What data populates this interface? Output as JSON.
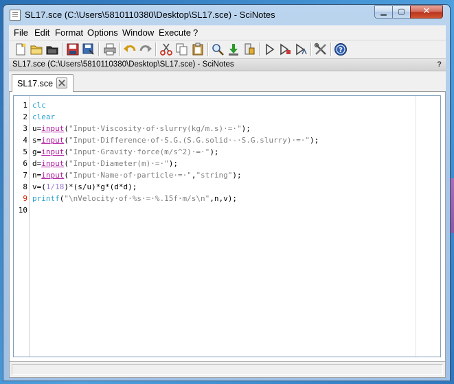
{
  "window": {
    "title": "SL17.sce (C:\\Users\\5810110380\\Desktop\\SL17.sce) - SciNotes",
    "controls": {
      "minimize": "▁",
      "maximize": "▢",
      "close": "✕"
    }
  },
  "menubar": {
    "items": [
      "File",
      "Edit",
      "Format",
      "Options",
      "Window",
      "Execute",
      "?"
    ]
  },
  "toolbar": {
    "icons": [
      "new-file-icon",
      "open-file-icon",
      "open-recent-icon",
      "save-icon",
      "save-as-icon",
      "print-icon",
      "undo-icon",
      "redo-icon",
      "cut-icon",
      "copy-icon",
      "paste-icon",
      "search-replace-icon",
      "load-into-scilab-icon",
      "execute-file-icon",
      "run-icon",
      "run-selection-icon",
      "run-with-echo-icon",
      "preferences-icon",
      "help-icon"
    ]
  },
  "document": {
    "title": "SL17.sce (C:\\Users\\5810110380\\Desktop\\SL17.sce) - SciNotes",
    "help_mark": "?"
  },
  "tabs": [
    {
      "label": "SL17.sce"
    }
  ],
  "editor": {
    "line_numbers": [
      "1",
      "2",
      "3",
      "4",
      "5",
      "6",
      "7",
      "8",
      "9",
      "10"
    ],
    "lines": [
      [
        {
          "t": "clc",
          "c": "kw"
        }
      ],
      [
        {
          "t": "clear",
          "c": "kw"
        }
      ],
      [
        {
          "t": "u="
        },
        {
          "t": "input",
          "c": "fn"
        },
        {
          "t": "("
        },
        {
          "t": "\"Input·Viscosity·of·slurry(kg/m.s)·=·\"",
          "c": "str"
        },
        {
          "t": ");"
        }
      ],
      [
        {
          "t": "s="
        },
        {
          "t": "input",
          "c": "fn"
        },
        {
          "t": "("
        },
        {
          "t": "\"Input·Difference·of·S.G.(S.G.solid·-·S.G.slurry)·=·\"",
          "c": "str"
        },
        {
          "t": ");"
        }
      ],
      [
        {
          "t": "g="
        },
        {
          "t": "input",
          "c": "fn"
        },
        {
          "t": "("
        },
        {
          "t": "\"Input·Gravity·force(m/s^2)·=·\"",
          "c": "str"
        },
        {
          "t": ");"
        }
      ],
      [
        {
          "t": "d="
        },
        {
          "t": "input",
          "c": "fn"
        },
        {
          "t": "("
        },
        {
          "t": "\"Input·Diameter(m)·=·\"",
          "c": "str"
        },
        {
          "t": ");"
        }
      ],
      [
        {
          "t": "n="
        },
        {
          "t": "input",
          "c": "fn"
        },
        {
          "t": "("
        },
        {
          "t": "\"Input·Name·of·particle·=·\"",
          "c": "str"
        },
        {
          "t": ","
        },
        {
          "t": "\"string\"",
          "c": "str"
        },
        {
          "t": ");"
        }
      ],
      [
        {
          "t": "v=("
        },
        {
          "t": "1/18",
          "c": "num"
        },
        {
          "t": ")*(s/u)*g*(d*d);"
        }
      ],
      [
        {
          "t": "printf",
          "c": "kw"
        },
        {
          "t": "("
        },
        {
          "t": "\"\\nVelocity·of·%s·=·%.15f·m/s\\n\"",
          "c": "str"
        },
        {
          "t": ",n,v);"
        }
      ],
      []
    ]
  },
  "colors": {
    "keyword": "#2aa2d0",
    "builtin": "#b01a9f",
    "string": "#808080",
    "number": "#9b7bd2",
    "line_number_highlight": "#cc2200"
  }
}
